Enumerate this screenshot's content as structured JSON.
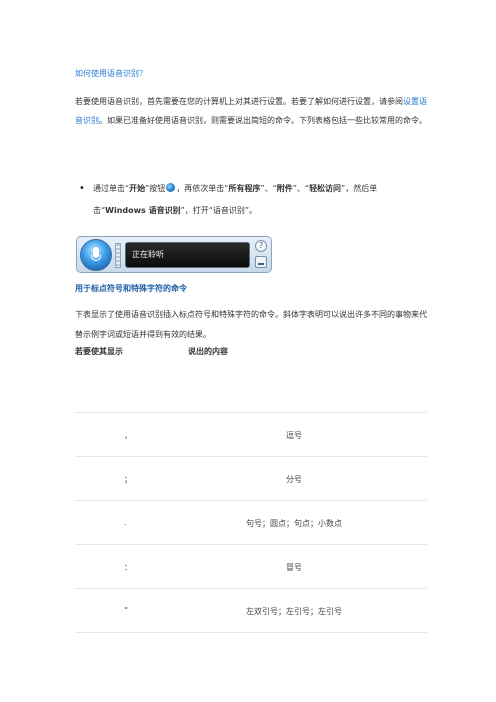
{
  "title_link": "如何使用语音识别？",
  "intro": {
    "part1": "若要使用语音识别，首先需要在您的计算机上对其进行设置。若要了解如何进行设置，请参阅",
    "link": "设置语音识别",
    "part2": "。如果已准备好使用语音识别，则需要说出简短的命令。下列表格包括一些比较常用的命令。"
  },
  "bullet": {
    "t1": "通过单击“",
    "b1": "开始",
    "t2": "”按钮",
    "start_icon": "windows-start-orb-icon",
    "t3": "，再依次单击“",
    "b2": "所有程序",
    "t4": "”、“",
    "b3": "附件",
    "t5": "”、“",
    "b4": "轻松访问",
    "t6": "”，然后单击“",
    "b5": "Windows 语音识别",
    "t7": "”，打开“语音识别”。"
  },
  "speech_widget": {
    "status_text": "正在聆听",
    "help_glyph": "?",
    "mic_icon": "microphone-icon"
  },
  "section_heading": "用于标点符号和特殊字符的命令",
  "description": "下表显示了使用语音识别插入标点符号和特殊字符的命令。斜体字表明可以说出许多不同的事物来代替示例字词或短语并得到有效的结果。",
  "table": {
    "col1": "若要使其显示",
    "col2": "说出的内容",
    "rows": [
      {
        "symbol": "，",
        "say": "逗号"
      },
      {
        "symbol": "；",
        "say": "分号"
      },
      {
        "symbol": ".",
        "say": "句号；圆点；句点；小数点"
      },
      {
        "symbol": "：",
        "say": "冒号"
      },
      {
        "symbol": "“",
        "say": "左双引号；左引号；左引号"
      }
    ]
  }
}
